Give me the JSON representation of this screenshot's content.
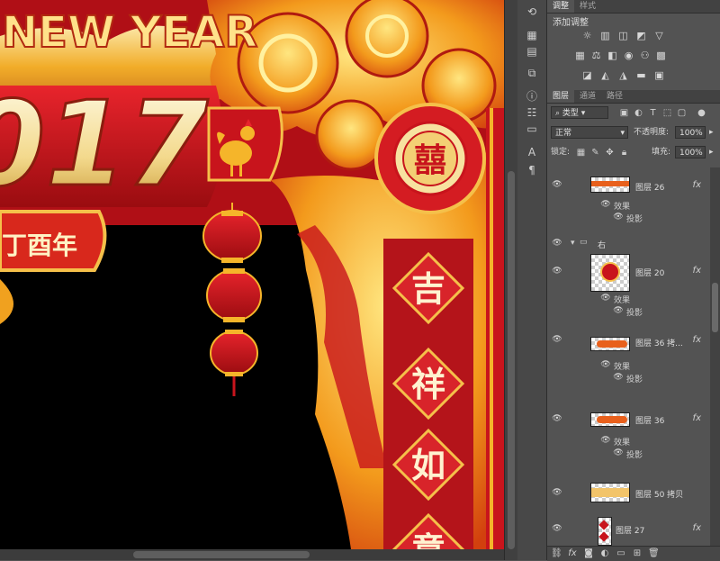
{
  "canvas": {
    "banner_text": "NEW YEAR",
    "year_text": "017",
    "subtitle": "丁酉年",
    "medallion_char": "囍",
    "couplet": [
      "吉",
      "祥",
      "如",
      "意"
    ]
  },
  "panel": {
    "top_tabs": [
      "调整",
      "样式"
    ],
    "adjust_title": "添加调整",
    "layer_tabs": [
      "图层",
      "通道",
      "路径"
    ],
    "filter_kind": "类型",
    "blend_mode": "正常",
    "opacity_label": "不透明度:",
    "opacity_value": "100%",
    "lock_label": "锁定:",
    "fill_label": "填充:",
    "fill_value": "100%",
    "layers": [
      {
        "name": "图层 26",
        "fx": "fx"
      },
      {
        "effects_label": "效果",
        "shadow_label": "投影"
      },
      {
        "group_name": "右"
      },
      {
        "name": "图层 20",
        "fx": "fx"
      },
      {
        "effects_label": "效果",
        "shadow_label": "投影"
      },
      {
        "name": "图层 36 拷...",
        "fx": "fx"
      },
      {
        "effects_label": "效果",
        "shadow_label": "投影"
      },
      {
        "name": "图层 36",
        "fx": "fx"
      },
      {
        "effects_label": "效果",
        "shadow_label": "投影"
      },
      {
        "name": "图层 50 拷贝"
      },
      {
        "name": "图层 27",
        "fx": "fx"
      }
    ],
    "bottom_icons": [
      "link-icon",
      "fx-icon",
      "mask-icon",
      "adjustment-icon",
      "folder-icon",
      "new-layer-icon",
      "trash-icon"
    ]
  },
  "colors": {
    "red": "#c8141c",
    "deep_red": "#8e0a0e",
    "gold": "#f5b52a",
    "yellow": "#ffe066"
  }
}
